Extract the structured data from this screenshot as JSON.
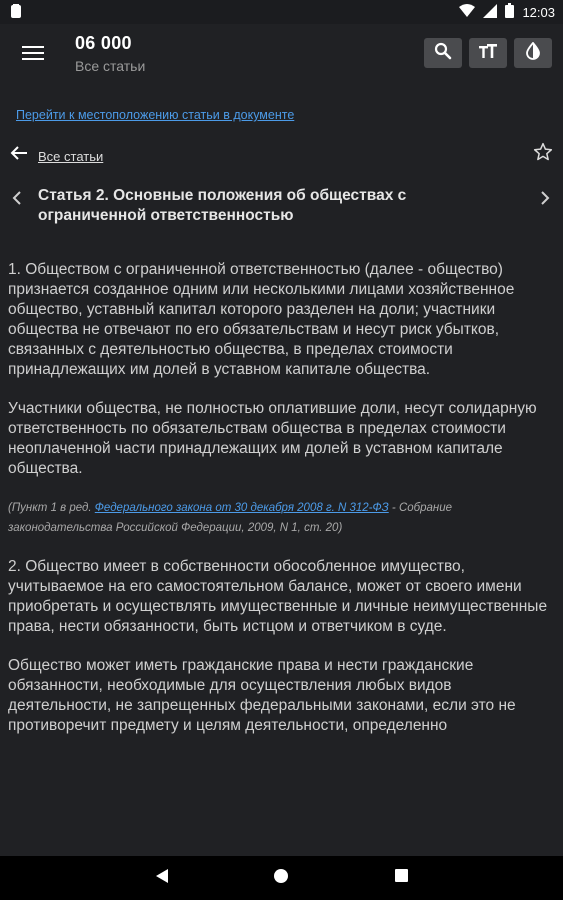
{
  "status_bar": {
    "time": "12:03"
  },
  "app_bar": {
    "title": "06 000",
    "subtitle": "Все статьи"
  },
  "goto_link": "Перейти к местоположению статьи в документе",
  "nav": {
    "back_label": "Все статьи"
  },
  "article": {
    "title": "Статья 2. Основные положения об обществах с ограниченной ответственностью",
    "paragraphs": [
      "1. Обществом с ограниченной ответственностью (далее - общество) признается созданное одним или несколькими лицами хозяйственное общество, уставный капитал которого разделен на доли; участники общества не отвечают по его обязательствам и несут риск убытков, связанных с деятельностью общества, в пределах стоимости принадлежащих им долей в уставном капитале общества.",
      "Участники общества, не полностью оплатившие доли, несут солидарную ответственность по обязательствам общества в пределах стоимости неоплаченной части принадлежащих им долей в уставном капитале общества.",
      "2. Общество имеет в собственности обособленное имущество, учитываемое на его самостоятельном балансе, может от своего имени приобретать и осуществлять имущественные и личные неимущественные права, нести обязанности, быть истцом и ответчиком в суде.",
      "Общество может иметь гражданские права и нести гражданские обязанности, необходимые для осуществления любых видов деятельности, не запрещенных федеральными законами, если это не противоречит предмету и целям деятельности, определенно"
    ],
    "note": {
      "prefix": "(Пункт 1 в ред. ",
      "link": "Федерального закона от 30 декабря 2008 г. N 312-ФЗ",
      "suffix": " - Собрание законодательства Российской Федерации, 2009, N 1, ст. 20)"
    }
  }
}
